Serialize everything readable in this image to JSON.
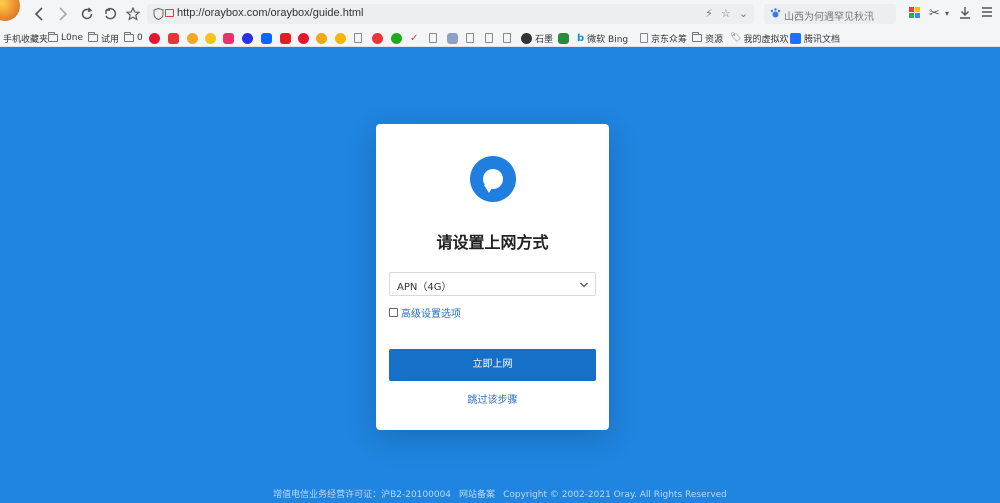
{
  "browser": {
    "url": "http://oraybox.com/oraybox/guide.html",
    "search_placeholder": "山西为何遇罕见秋汛"
  },
  "bookmarks": [
    {
      "type": "folder",
      "label": "手机收藏夹"
    },
    {
      "type": "folder",
      "label": "L0ne"
    },
    {
      "type": "folder",
      "label": "试用"
    },
    {
      "type": "folder",
      "label": "0"
    },
    {
      "type": "site",
      "label": "石墨"
    },
    {
      "type": "site",
      "label": "微软 Bing"
    },
    {
      "type": "page",
      "label": "京东众筹"
    },
    {
      "type": "folder",
      "label": "资源"
    },
    {
      "type": "site",
      "label": "我的虚拟欢"
    },
    {
      "type": "site",
      "label": "腾讯文档"
    }
  ],
  "card": {
    "title": "请设置上网方式",
    "select_value": "APN（4G）",
    "advanced_label": "高级设置选项",
    "primary_button": "立即上网",
    "skip_link": "跳过该步骤"
  },
  "footer": {
    "license": "增值电信业务经营许可证：沪B2-20100004",
    "record": "网站备案",
    "copyright": "Copyright © 2002-2021 Oray. All Rights Reserved"
  },
  "colors": {
    "background": "#1f85e0",
    "primary": "#1670c7",
    "link": "#2a6fc9"
  }
}
